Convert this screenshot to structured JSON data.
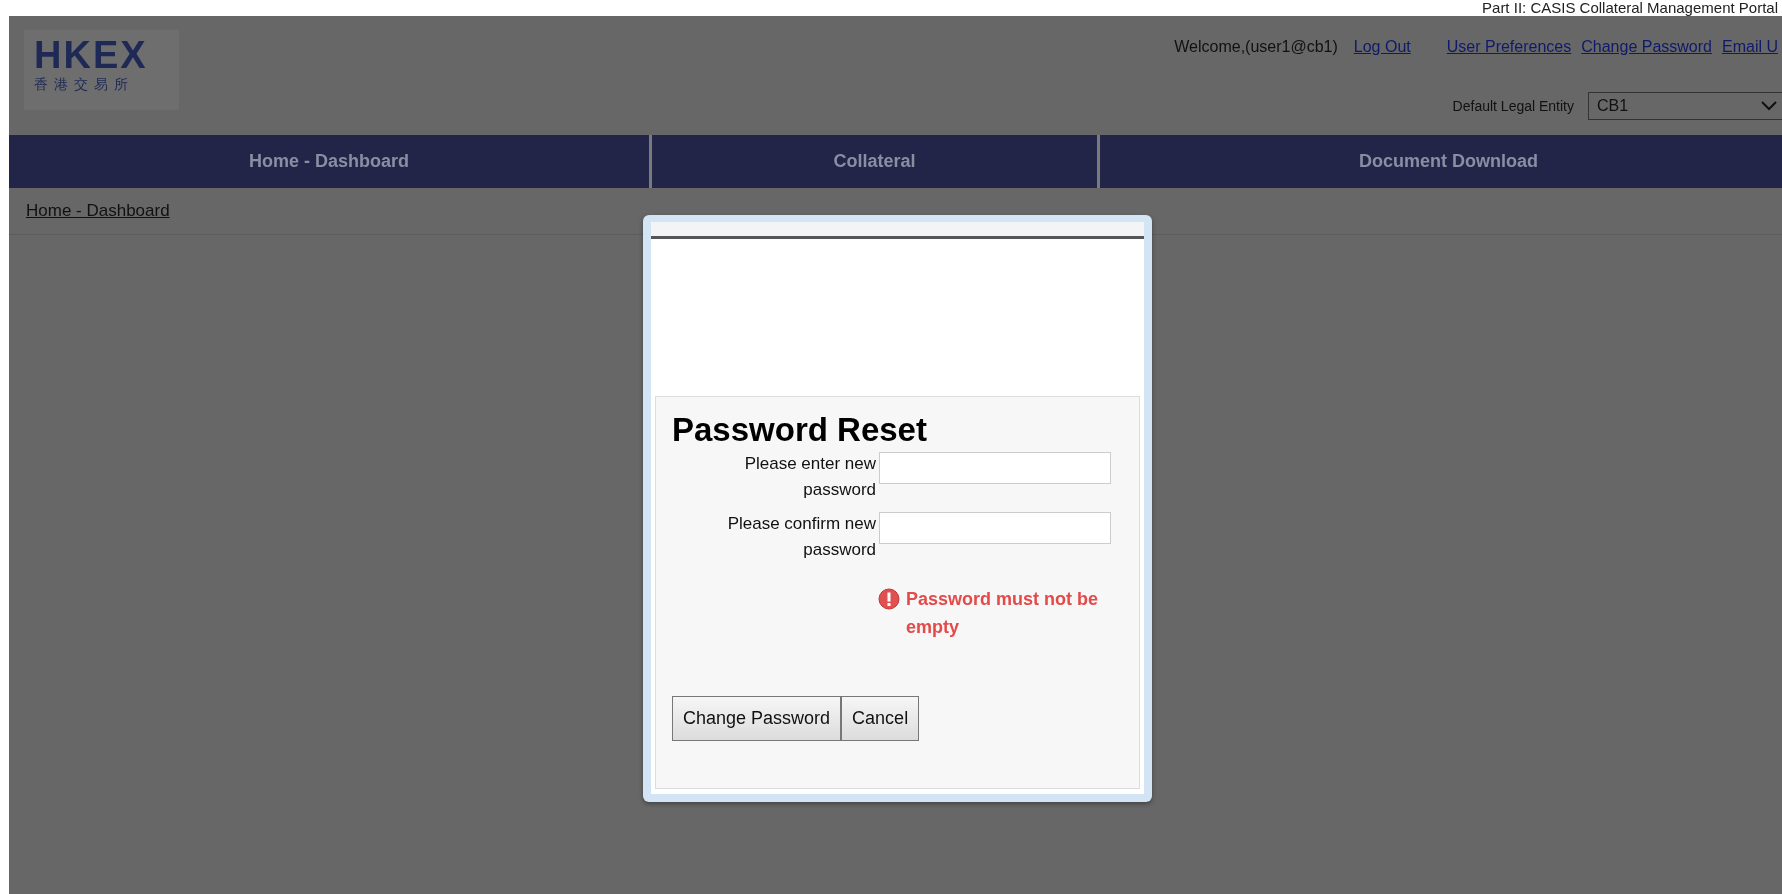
{
  "document_header": "Part II: CASIS Collateral Management Portal",
  "logo": {
    "wordmark": "HKEX",
    "subtitle": "香港交易所"
  },
  "user_bar": {
    "welcome": "Welcome,(user1@cb1)",
    "links": [
      "Log Out",
      "User Preferences",
      "Change Password",
      "Email U"
    ]
  },
  "legal_entity": {
    "label": "Default Legal Entity",
    "value": "CB1"
  },
  "nav_tabs": [
    {
      "label": "Home - Dashboard"
    },
    {
      "label": "Collateral"
    },
    {
      "label": "Document Download"
    }
  ],
  "breadcrumb": "Home - Dashboard",
  "dialog": {
    "title": "Password Reset",
    "fields": [
      {
        "label": "Please enter new password"
      },
      {
        "label": "Please confirm new password"
      }
    ],
    "error": "Password must not be empty",
    "buttons": [
      "Change Password",
      "Cancel"
    ]
  }
}
